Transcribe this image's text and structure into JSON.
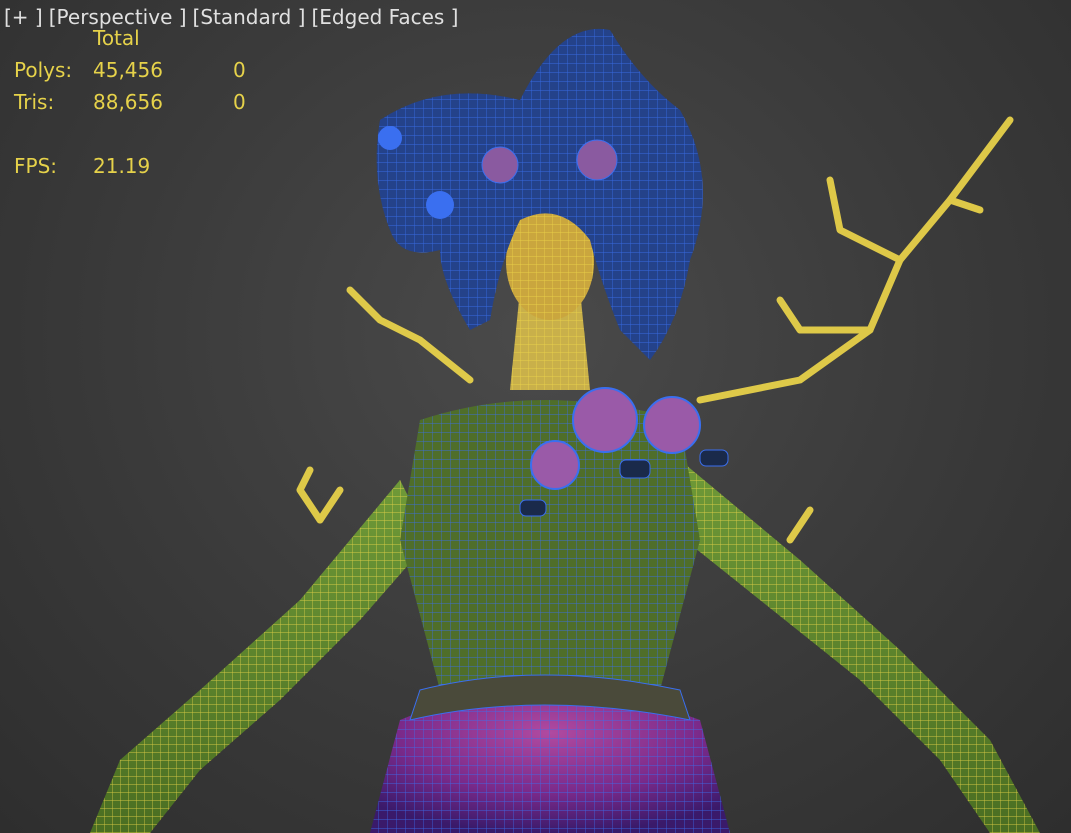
{
  "viewport": {
    "menu": {
      "plus": "[+ ]",
      "view": "[Perspective ]",
      "shading": "[Standard ]",
      "display": "[Edged Faces ]"
    },
    "stats": {
      "header": "Total",
      "polys_label": "Polys:",
      "polys_total": "45,456",
      "polys_selected": "0",
      "tris_label": "Tris:",
      "tris_total": "88,656",
      "tris_selected": "0",
      "fps_label": "FPS:",
      "fps_value": "21.19"
    }
  },
  "colors": {
    "stats_text": "#e6d24a",
    "menu_text": "#e0e0e0",
    "wire_yellow": "#f0d84a",
    "wire_blue": "#2a5fd8",
    "skin_green": "#5f8a2c",
    "skirt_purple": "#8a2a8c"
  }
}
